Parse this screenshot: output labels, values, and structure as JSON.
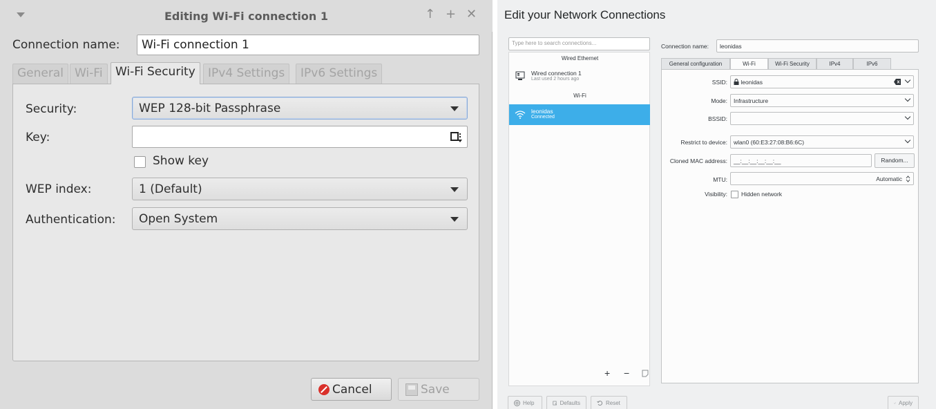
{
  "gtk": {
    "title": "Editing Wi-Fi connection 1",
    "conn_name_label": "Connection name:",
    "conn_name_value": "Wi-Fi connection 1",
    "tabs": [
      "General",
      "Wi-Fi",
      "Wi-Fi Security",
      "IPv4 Settings",
      "IPv6 Settings"
    ],
    "active_tab": "Wi-Fi Security",
    "security_label": "Security:",
    "security_value": "WEP 128-bit Passphrase",
    "key_label": "Key:",
    "key_value": "",
    "show_key_label": "Show key",
    "show_key_checked": false,
    "wep_index_label": "WEP index:",
    "wep_index_value": "1 (Default)",
    "auth_label": "Authentication:",
    "auth_value": "Open System",
    "cancel_label": "Cancel",
    "save_label": "Save"
  },
  "kde": {
    "title": "Edit your Network Connections",
    "search_placeholder": "Type here to search connections...",
    "sections": {
      "wired": "Wired Ethernet",
      "wifi": "Wi-Fi"
    },
    "connections": [
      {
        "name": "Wired connection 1",
        "sub": "Last used 2 hours ago",
        "icon": "wired-icon",
        "selected": false
      },
      {
        "name": "leonidas",
        "sub": "Connected",
        "icon": "wifi-icon",
        "selected": true
      }
    ],
    "list_tools": {
      "add": "+",
      "remove": "−",
      "export": "export-icon"
    },
    "conn_name_label": "Connection name:",
    "conn_name_value": "leonidas",
    "tabs": [
      "General configuration",
      "Wi-Fi",
      "Wi-Fi Security",
      "IPv4",
      "IPv6"
    ],
    "active_tab": "Wi-Fi",
    "ssid_label": "SSID:",
    "ssid_value": "leonidas",
    "mode_label": "Mode:",
    "mode_value": "Infrastructure",
    "bssid_label": "BSSID:",
    "bssid_value": "",
    "restrict_label": "Restrict to device:",
    "restrict_value": "wlan0 (60:E3:27:08:B6:6C)",
    "cloned_label": "Cloned MAC address:",
    "cloned_value": "__:__:__:__:__:__",
    "random_label": "Random...",
    "mtu_label": "MTU:",
    "mtu_value": "Automatic",
    "visibility_label": "Visibility:",
    "hidden_label": "Hidden network",
    "hidden_checked": false,
    "bottom": {
      "help": "Help",
      "defaults": "Defaults",
      "reset": "Reset",
      "apply": "Apply"
    },
    "accent_color": "#3daee9"
  }
}
